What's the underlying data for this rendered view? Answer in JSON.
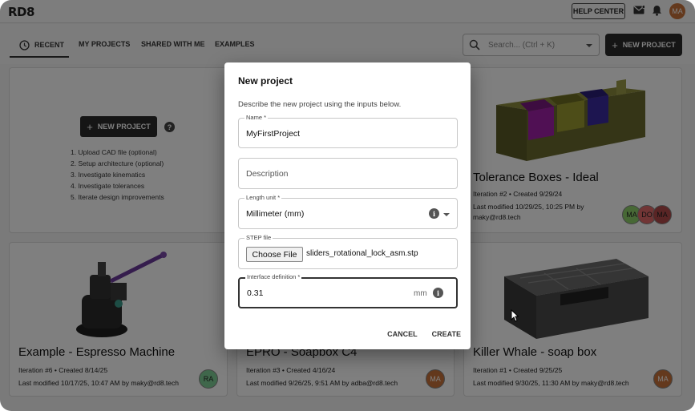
{
  "topbar": {
    "logo": "RD8",
    "help_label": "HELP CENTER",
    "avatar_initials": "MA"
  },
  "tabs": [
    {
      "label": "RECENT"
    },
    {
      "label": "MY PROJECTS"
    },
    {
      "label": "SHARED WITH ME"
    },
    {
      "label": "EXAMPLES"
    }
  ],
  "search": {
    "placeholder": "Search... (Ctrl + K)"
  },
  "new_project_label": "NEW PROJECT",
  "starter_card": {
    "button_label": "NEW PROJECT",
    "help": "?",
    "steps": [
      "1. Upload CAD file (optional)",
      "2. Setup architecture (optional)",
      "3. Investigate kinematics",
      "4. Investigate tolerances",
      "5. Iterate design improvements"
    ]
  },
  "cards": [
    {
      "title": "Tolerance Boxes - Ideal",
      "iteration": "Iteration #2 • Created 9/29/24",
      "modified": "Last modified 10/29/25, 10:25 PM by",
      "modified2": "maky@rd8.tech",
      "avatars": [
        "MA",
        "DO",
        "MA"
      ]
    },
    {
      "title": "Example - Espresso Machine",
      "iteration": "Iteration #6 • Created 8/14/25",
      "modified": "Last modified 10/17/25, 10:47 AM by maky@rd8.tech",
      "avatar": "RA"
    },
    {
      "title": "EPRO - Soapbox C4",
      "iteration": "Iteration #3 • Created 4/16/24",
      "modified": "Last modified 9/26/25, 9:51 AM by adba@rd8.tech",
      "avatar": "MA"
    },
    {
      "title": "Killer Whale - soap box",
      "iteration": "Iteration #1 • Created 9/25/25",
      "modified": "Last modified 9/30/25, 11:30 AM by maky@rd8.tech",
      "avatar": "MA"
    }
  ],
  "dialog": {
    "title": "New project",
    "description": "Describe the new project using the inputs below.",
    "name_label": "Name *",
    "name_value": "MyFirstProject",
    "description_placeholder": "Description",
    "length_label": "Length unit *",
    "length_value": "Millimeter (mm)",
    "step_label": "STEP file",
    "choose_file": "Choose File",
    "file_name": "sliders_rotational_lock_asm.stp",
    "interface_label": "Interface definition *",
    "interface_value": "0.31",
    "interface_unit": "mm",
    "cancel": "CANCEL",
    "create": "CREATE"
  },
  "colors": {
    "avatar_ma": "#c9733a",
    "avatar_ra": "#7fcf97",
    "avatar_ma_green": "#8fd16a",
    "avatar_do": "#e36b6b",
    "avatar_ma_dark": "#b34a4a"
  }
}
